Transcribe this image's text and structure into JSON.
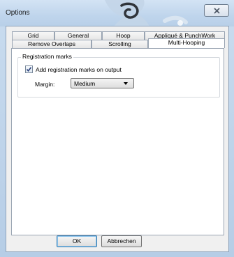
{
  "window": {
    "title": "Options",
    "close_icon": "close-icon"
  },
  "tabs": {
    "row_top": [
      {
        "label": "Grid"
      },
      {
        "label": "General"
      },
      {
        "label": "Hoop"
      },
      {
        "label": "Appliqué & PunchWork"
      }
    ],
    "row_bottom": [
      {
        "label": "Remove Overlaps"
      },
      {
        "label": "Scrolling"
      },
      {
        "label": "Multi-Hooping",
        "active": true
      }
    ]
  },
  "registration": {
    "group_label": "Registration marks",
    "checkbox_label": "Add registration marks on output",
    "checked": true,
    "margin_label": "Margin:",
    "margin_value": "Medium"
  },
  "buttons": {
    "ok": "OK",
    "cancel": "Abbrechen"
  }
}
